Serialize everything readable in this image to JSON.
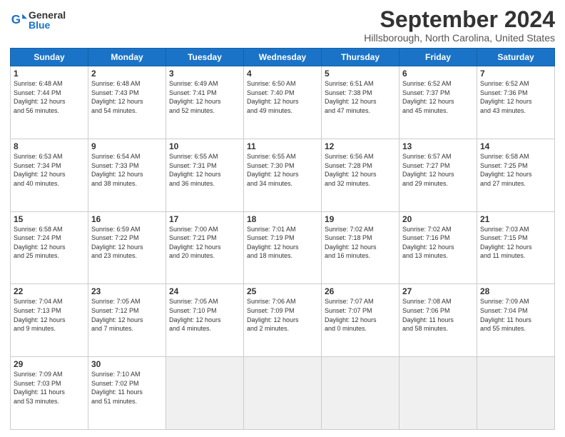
{
  "header": {
    "logo_text_general": "General",
    "logo_text_blue": "Blue",
    "title": "September 2024",
    "location": "Hillsborough, North Carolina, United States"
  },
  "calendar": {
    "days_of_week": [
      "Sunday",
      "Monday",
      "Tuesday",
      "Wednesday",
      "Thursday",
      "Friday",
      "Saturday"
    ],
    "weeks": [
      [
        {
          "day": "1",
          "info": "Sunrise: 6:48 AM\nSunset: 7:44 PM\nDaylight: 12 hours\nand 56 minutes."
        },
        {
          "day": "2",
          "info": "Sunrise: 6:48 AM\nSunset: 7:43 PM\nDaylight: 12 hours\nand 54 minutes."
        },
        {
          "day": "3",
          "info": "Sunrise: 6:49 AM\nSunset: 7:41 PM\nDaylight: 12 hours\nand 52 minutes."
        },
        {
          "day": "4",
          "info": "Sunrise: 6:50 AM\nSunset: 7:40 PM\nDaylight: 12 hours\nand 49 minutes."
        },
        {
          "day": "5",
          "info": "Sunrise: 6:51 AM\nSunset: 7:38 PM\nDaylight: 12 hours\nand 47 minutes."
        },
        {
          "day": "6",
          "info": "Sunrise: 6:52 AM\nSunset: 7:37 PM\nDaylight: 12 hours\nand 45 minutes."
        },
        {
          "day": "7",
          "info": "Sunrise: 6:52 AM\nSunset: 7:36 PM\nDaylight: 12 hours\nand 43 minutes."
        }
      ],
      [
        {
          "day": "8",
          "info": "Sunrise: 6:53 AM\nSunset: 7:34 PM\nDaylight: 12 hours\nand 40 minutes."
        },
        {
          "day": "9",
          "info": "Sunrise: 6:54 AM\nSunset: 7:33 PM\nDaylight: 12 hours\nand 38 minutes."
        },
        {
          "day": "10",
          "info": "Sunrise: 6:55 AM\nSunset: 7:31 PM\nDaylight: 12 hours\nand 36 minutes."
        },
        {
          "day": "11",
          "info": "Sunrise: 6:55 AM\nSunset: 7:30 PM\nDaylight: 12 hours\nand 34 minutes."
        },
        {
          "day": "12",
          "info": "Sunrise: 6:56 AM\nSunset: 7:28 PM\nDaylight: 12 hours\nand 32 minutes."
        },
        {
          "day": "13",
          "info": "Sunrise: 6:57 AM\nSunset: 7:27 PM\nDaylight: 12 hours\nand 29 minutes."
        },
        {
          "day": "14",
          "info": "Sunrise: 6:58 AM\nSunset: 7:25 PM\nDaylight: 12 hours\nand 27 minutes."
        }
      ],
      [
        {
          "day": "15",
          "info": "Sunrise: 6:58 AM\nSunset: 7:24 PM\nDaylight: 12 hours\nand 25 minutes."
        },
        {
          "day": "16",
          "info": "Sunrise: 6:59 AM\nSunset: 7:22 PM\nDaylight: 12 hours\nand 23 minutes."
        },
        {
          "day": "17",
          "info": "Sunrise: 7:00 AM\nSunset: 7:21 PM\nDaylight: 12 hours\nand 20 minutes."
        },
        {
          "day": "18",
          "info": "Sunrise: 7:01 AM\nSunset: 7:19 PM\nDaylight: 12 hours\nand 18 minutes."
        },
        {
          "day": "19",
          "info": "Sunrise: 7:02 AM\nSunset: 7:18 PM\nDaylight: 12 hours\nand 16 minutes."
        },
        {
          "day": "20",
          "info": "Sunrise: 7:02 AM\nSunset: 7:16 PM\nDaylight: 12 hours\nand 13 minutes."
        },
        {
          "day": "21",
          "info": "Sunrise: 7:03 AM\nSunset: 7:15 PM\nDaylight: 12 hours\nand 11 minutes."
        }
      ],
      [
        {
          "day": "22",
          "info": "Sunrise: 7:04 AM\nSunset: 7:13 PM\nDaylight: 12 hours\nand 9 minutes."
        },
        {
          "day": "23",
          "info": "Sunrise: 7:05 AM\nSunset: 7:12 PM\nDaylight: 12 hours\nand 7 minutes."
        },
        {
          "day": "24",
          "info": "Sunrise: 7:05 AM\nSunset: 7:10 PM\nDaylight: 12 hours\nand 4 minutes."
        },
        {
          "day": "25",
          "info": "Sunrise: 7:06 AM\nSunset: 7:09 PM\nDaylight: 12 hours\nand 2 minutes."
        },
        {
          "day": "26",
          "info": "Sunrise: 7:07 AM\nSunset: 7:07 PM\nDaylight: 12 hours\nand 0 minutes."
        },
        {
          "day": "27",
          "info": "Sunrise: 7:08 AM\nSunset: 7:06 PM\nDaylight: 11 hours\nand 58 minutes."
        },
        {
          "day": "28",
          "info": "Sunrise: 7:09 AM\nSunset: 7:04 PM\nDaylight: 11 hours\nand 55 minutes."
        }
      ],
      [
        {
          "day": "29",
          "info": "Sunrise: 7:09 AM\nSunset: 7:03 PM\nDaylight: 11 hours\nand 53 minutes."
        },
        {
          "day": "30",
          "info": "Sunrise: 7:10 AM\nSunset: 7:02 PM\nDaylight: 11 hours\nand 51 minutes."
        },
        {
          "day": "",
          "info": ""
        },
        {
          "day": "",
          "info": ""
        },
        {
          "day": "",
          "info": ""
        },
        {
          "day": "",
          "info": ""
        },
        {
          "day": "",
          "info": ""
        }
      ]
    ]
  }
}
